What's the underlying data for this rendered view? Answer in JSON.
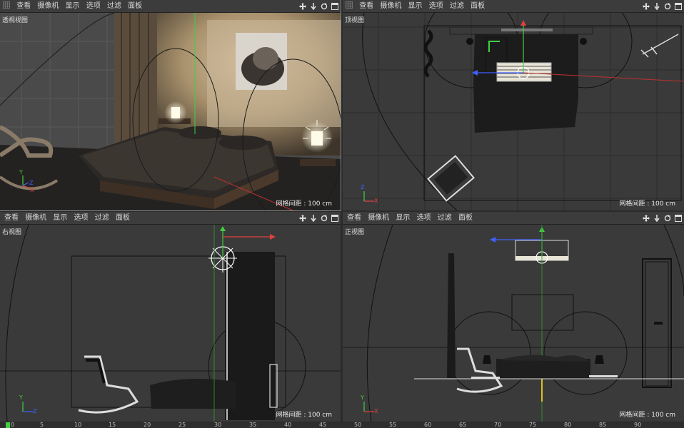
{
  "menus": [
    "查看",
    "摄像机",
    "显示",
    "选项",
    "过滤",
    "面板"
  ],
  "icons": [
    "move-view-icon",
    "zoom-view-icon",
    "rotate-view-icon",
    "maximize-view-icon"
  ],
  "viewports": {
    "perspective": {
      "name": "透视视图",
      "grid": "网格间距 : 100 cm"
    },
    "top": {
      "name": "顶视图",
      "grid": "网格间距 : 100 cm"
    },
    "right": {
      "name": "右视图",
      "grid": "网格间距 : 100 cm"
    },
    "front": {
      "name": "正视图",
      "grid": "网格间距 : 100 cm"
    }
  },
  "axis_labels": {
    "x": "X",
    "y": "Y",
    "z": "Z"
  },
  "timeline": {
    "ticks": [
      "0",
      "5",
      "10",
      "15",
      "20",
      "25",
      "30",
      "35",
      "40",
      "45",
      "50",
      "55",
      "60",
      "65",
      "70",
      "75",
      "80",
      "85",
      "90"
    ]
  },
  "colors": {
    "x_axis": "#e04040",
    "y_axis": "#40d040",
    "z_axis": "#4060ff",
    "viewport_bg": "#3a3a3a"
  }
}
